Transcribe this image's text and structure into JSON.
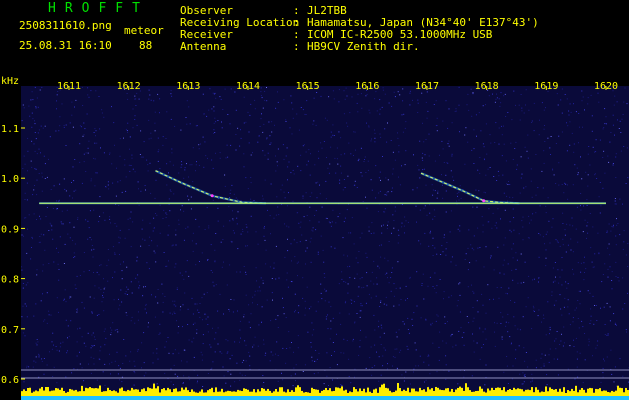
{
  "header": {
    "title": "HROFFT",
    "filename": "2508311610.png",
    "mode": "meteor",
    "datetime": "25.08.31 16:10",
    "count": "88",
    "fields": [
      {
        "label": "Observer",
        "sep": ":",
        "value": "JL2TBB"
      },
      {
        "label": "Receiving Location",
        "sep": ":",
        "value": "Hamamatsu, Japan (N34°40' E137°43')"
      },
      {
        "label": "Receiver",
        "sep": ":",
        "value": "ICOM IC-R2500 53.1000MHz USB"
      },
      {
        "label": "Antenna",
        "sep": ":",
        "value": "HB9CV Zenith dir."
      }
    ]
  },
  "colors": {
    "background": "#0a0a3a",
    "text": "#ffff00",
    "title": "#00e000",
    "carrier": "#40d0ff",
    "spectrum": "#ffee00"
  },
  "chart_data": {
    "type": "heatmap",
    "y_unit": "kHz",
    "x_ticks": [
      "1611",
      "1612",
      "1613",
      "1614",
      "1615",
      "1616",
      "1617",
      "1618",
      "1619",
      "1620"
    ],
    "y_ticks": [
      "1.1",
      "1.0",
      "0.9",
      "0.8",
      "0.7",
      "0.6"
    ],
    "ylim": [
      0.6,
      1.1
    ],
    "xlim": [
      1610.3,
      1620
    ],
    "carrier": {
      "freq": 0.95,
      "x_start": 1610.5,
      "x_end": 1620
    },
    "echoes": [
      {
        "points": [
          [
            1612.45,
            1.015
          ],
          [
            1612.9,
            0.99
          ],
          [
            1613.4,
            0.965
          ],
          [
            1613.9,
            0.952
          ],
          [
            1614.3,
            0.95
          ]
        ]
      },
      {
        "points": [
          [
            1616.9,
            1.01
          ],
          [
            1617.3,
            0.99
          ],
          [
            1617.6,
            0.975
          ],
          [
            1617.95,
            0.955
          ],
          [
            1618.2,
            0.952
          ],
          [
            1618.55,
            0.95
          ]
        ]
      }
    ]
  }
}
